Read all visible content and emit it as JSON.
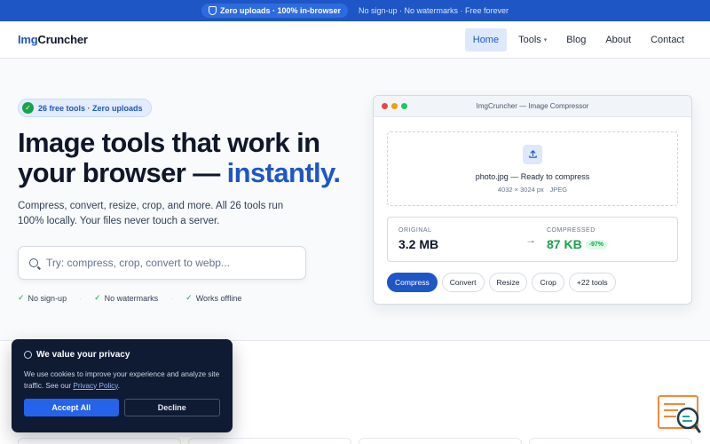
{
  "banner": {
    "pill": "Zero uploads · 100% in-browser",
    "tagline": "No sign-up · No watermarks · Free forever"
  },
  "nav": {
    "logo_a": "Img",
    "logo_b": "Cruncher",
    "links": [
      {
        "label": "Home"
      },
      {
        "label": "Tools"
      },
      {
        "label": "Blog"
      },
      {
        "label": "About"
      },
      {
        "label": "Contact"
      }
    ]
  },
  "hero": {
    "badge": "26 free tools · Zero uploads",
    "headline_a": "Image tools that work in your browser — ",
    "headline_accent": "instantly.",
    "subtext": "Compress, convert, resize, crop, and more. All 26 tools run 100% locally. Your files never touch a server.",
    "search_placeholder": "Try: compress, crop, convert to webp...",
    "features": [
      "No sign-up",
      "No watermarks",
      "Works offline"
    ],
    "separator": "·"
  },
  "preview": {
    "window_title": "ImgCruncher — Image Compressor",
    "file_name": "photo.jpg — Ready to compress",
    "file_dims": "4032 × 3024 px",
    "file_format": "JPEG",
    "original_label": "ORIGINAL",
    "original_value": "3.2 MB",
    "compressed_label": "COMPRESSED",
    "compressed_value": "87 KB",
    "compressed_pct": "-97%",
    "tools": [
      "Compress",
      "Convert",
      "Resize",
      "Crop",
      "+22 tools"
    ]
  },
  "cookie": {
    "title": "We value your privacy",
    "text": "We use cookies to improve your experience and analyze site traffic. See our ",
    "link": "Privacy Policy",
    "period": ".",
    "accept": "Accept All",
    "decline": "Decline"
  },
  "colors": {
    "brand": "#1e56c6",
    "success": "#16a34a",
    "cookie_bg": "#0f1b33"
  }
}
